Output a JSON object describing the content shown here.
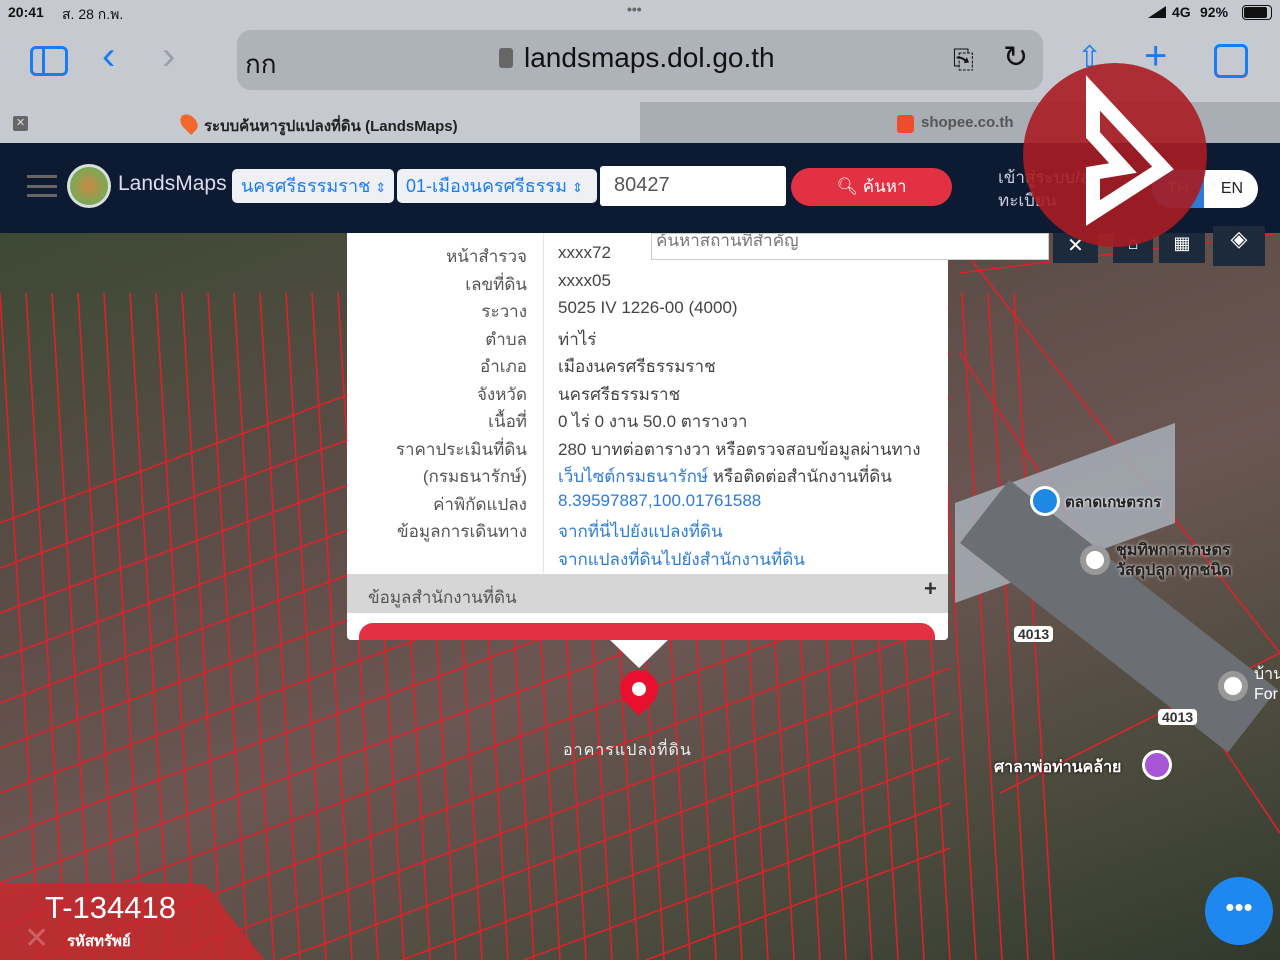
{
  "status": {
    "time": "20:41",
    "date": "ส. 28 ก.พ.",
    "network": "4G",
    "battery": "92%"
  },
  "browser": {
    "reader": "กก",
    "url": "landsmaps.dol.go.th",
    "tabs": [
      {
        "title": "ระบบค้นหารูปแปลงที่ดิน (LandsMaps)"
      },
      {
        "title": "shopee.co.th"
      }
    ]
  },
  "nav": {
    "brand": "LandsMaps",
    "province": "นครศรีธรรมราช",
    "district": "01-เมืองนครศรีธรรม",
    "parcel_input": "80427",
    "search_button": "ค้นหา",
    "login": "เข้าสู่ระบบ/ลงทะเบียน",
    "lang_th": "TH",
    "lang_en": "EN"
  },
  "place_search": {
    "placeholder": "ค้นหาสถานที่สำคัญ"
  },
  "parcel": {
    "rows": [
      {
        "label": "หน้าสำรวจ",
        "value": "xxxx72"
      },
      {
        "label": "เลขที่ดิน",
        "value": "xxxx05"
      },
      {
        "label": "ระวาง",
        "value": "5025 IV 1226-00 (4000)"
      },
      {
        "label": "ตำบล",
        "value": "ท่าไร่"
      },
      {
        "label": "อำเภอ",
        "value": "เมืองนครศรีธรรมราช"
      },
      {
        "label": "จังหวัด",
        "value": "นครศรีธรรมราช"
      },
      {
        "label": "เนื้อที่",
        "value": "0 ไร่ 0 งาน 50.0 ตารางวา"
      },
      {
        "label": "ราคาประเมินที่ดิน",
        "value": "280 บาทต่อตารางวา หรือตรวจสอบข้อมูลผ่านทาง"
      },
      {
        "label": "(กรมธนารักษ์)",
        "link": "เว็บไซต์กรมธนารักษ์",
        "value": " หรือติดต่อสำนักงานที่ดิน"
      },
      {
        "label": "ค่าพิกัดแปลง",
        "link": "8.39597887,100.01761588"
      },
      {
        "label": "ข้อมูลการเดินทาง",
        "link": "จากที่นี่ไปยังแปลงที่ดิน"
      },
      {
        "label": "",
        "link": "จากแปลงที่ดินไปยังสำนักงานที่ดิน"
      }
    ],
    "office_section": "ข้อมูลสำนักงานที่ดิน"
  },
  "map": {
    "marker_label": "อาคารแปลงที่ดิน",
    "pois": [
      "ตลาดเกษตรกร",
      "ชุมทิพการเกษตร วัสดุปลูก ทุกชนิด",
      "ศาลาพ่อท่านคล้าย",
      "บ้าน For"
    ],
    "road_labels": [
      "4013",
      "4013"
    ]
  },
  "badge": {
    "code": "T-134418",
    "caption": "รหัสทรัพย์"
  },
  "colors": {
    "nav": "#0c1a32",
    "accent_red": "#e23142",
    "link": "#2d7bd6",
    "ios_blue": "#1a7cf5"
  }
}
